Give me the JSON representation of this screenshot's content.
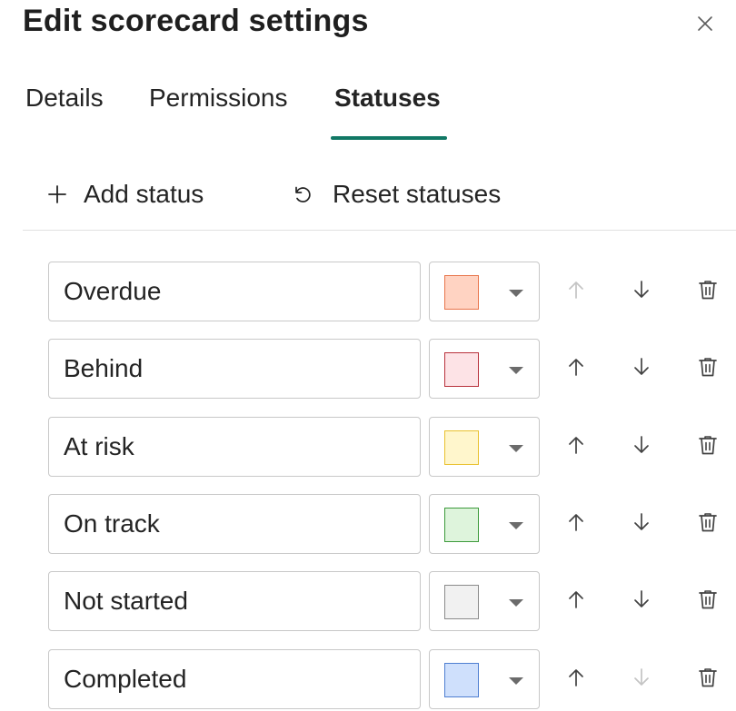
{
  "dialog": {
    "title": "Edit scorecard settings",
    "close_icon": "close-icon"
  },
  "tabs": [
    {
      "label": "Details",
      "active": false
    },
    {
      "label": "Permissions",
      "active": false
    },
    {
      "label": "Statuses",
      "active": true
    }
  ],
  "toolbar": {
    "add_label": "Add status",
    "add_icon": "plus-icon",
    "reset_label": "Reset statuses",
    "reset_icon": "undo-icon"
  },
  "colors": {
    "accent": "#117865",
    "icon": "#424242",
    "icon_disabled": "#c4c4c4"
  },
  "statuses": [
    {
      "name": "Overdue",
      "fill": "#ffd3c2",
      "border": "#e8754b",
      "up_enabled": false,
      "down_enabled": true
    },
    {
      "name": "Behind",
      "fill": "#fde3e6",
      "border": "#b8323c",
      "up_enabled": true,
      "down_enabled": true
    },
    {
      "name": "At risk",
      "fill": "#fff6cc",
      "border": "#e9c12e",
      "up_enabled": true,
      "down_enabled": true
    },
    {
      "name": "On track",
      "fill": "#def4dc",
      "border": "#3c9a3a",
      "up_enabled": true,
      "down_enabled": true
    },
    {
      "name": "Not started",
      "fill": "#f1f1f1",
      "border": "#8a8a8a",
      "up_enabled": true,
      "down_enabled": true
    },
    {
      "name": "Completed",
      "fill": "#cfe0fc",
      "border": "#4f7fd1",
      "up_enabled": true,
      "down_enabled": false
    }
  ]
}
